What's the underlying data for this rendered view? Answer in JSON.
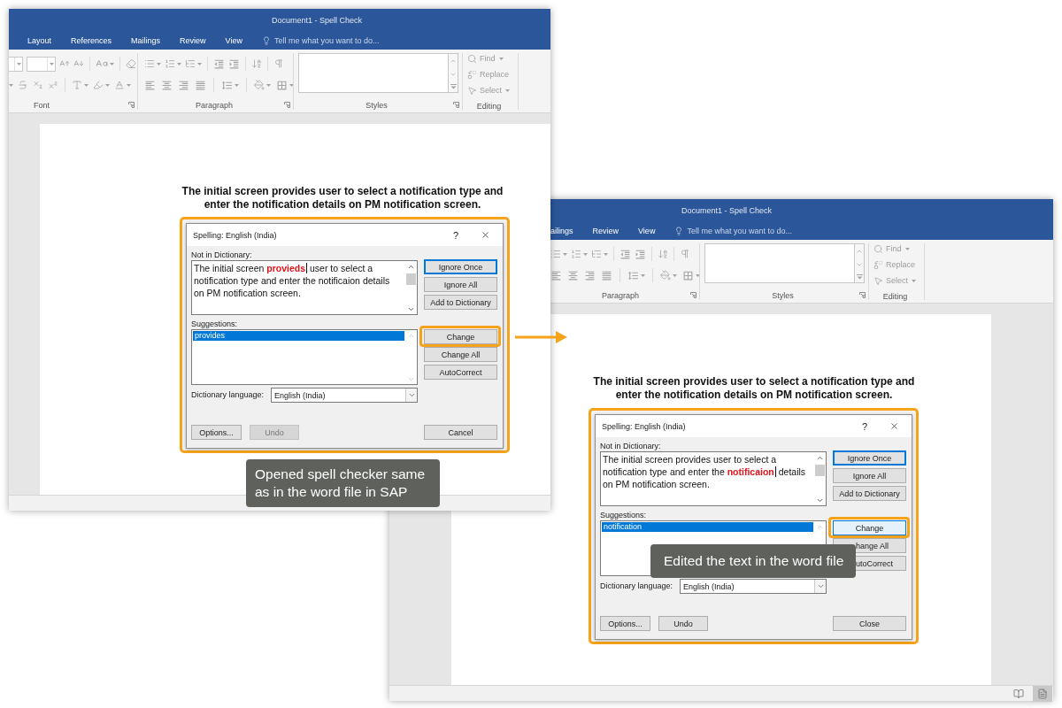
{
  "windows": [
    {
      "title": "Document1 - Spell Check",
      "tabs": [
        {
          "label": "Layout",
          "selected": false
        },
        {
          "label": "References",
          "selected": false
        },
        {
          "label": "Mailings",
          "selected": false
        },
        {
          "label": "Review",
          "selected": false
        },
        {
          "label": "View",
          "selected": false
        }
      ],
      "tell_me": {
        "placeholder": "Tell me what you want to do..."
      },
      "ribbon": {
        "disabled": true,
        "groups": [
          {
            "kind": "font",
            "label": "Font"
          },
          {
            "kind": "paragraph",
            "label": "Paragraph"
          },
          {
            "kind": "styles",
            "label": "Styles"
          },
          {
            "kind": "editing",
            "label": "Editing",
            "items": [
              {
                "kind": "find",
                "label": "Find"
              },
              {
                "kind": "replace",
                "label": "Replace"
              },
              {
                "kind": "select",
                "label": "Select"
              }
            ]
          }
        ]
      },
      "document": {
        "heading": "The initial screen provides user to select a notification type and\nenter the notification details on PM notification screen."
      },
      "dialog": {
        "title": "Spelling: English (India)",
        "help": "?",
        "not_in_dictionary": {
          "label": "Not in Dictionary:",
          "text": "The initial screen **provieds** user to select a\nnotification type and enter the notificaion details\non PM notification screen."
        },
        "dictionary_buttons": [
          {
            "label": "Ignore Once",
            "focused": true,
            "hovered": false,
            "annotated": false
          },
          {
            "label": "Ignore All",
            "focused": false,
            "hovered": false,
            "annotated": false
          },
          {
            "label": "Add to Dictionary",
            "focused": false,
            "hovered": false,
            "annotated": false
          }
        ],
        "suggestions": {
          "label": "Suggestions:",
          "items": [
            {
              "label": "provides",
              "selected": true
            }
          ]
        },
        "change_buttons": [
          {
            "label": "Change",
            "focused": false,
            "hovered": false,
            "annotated": true
          },
          {
            "label": "Change All",
            "focused": false,
            "hovered": false,
            "annotated": false
          },
          {
            "label": "AutoCorrect",
            "focused": false,
            "hovered": false,
            "annotated": false
          }
        ],
        "language": {
          "label": "Dictionary language:",
          "value": "English (India)"
        },
        "footer_buttons": [
          {
            "label": "Options...",
            "disabled": false
          },
          {
            "label": "Undo",
            "disabled": true
          }
        ],
        "dismiss_button": {
          "label": "Cancel"
        }
      },
      "callout": "Opened spell checker same\nas in the word file in SAP"
    },
    {
      "title": "Document1 - Spell Check",
      "tabs": [
        {
          "label": "ailings",
          "selected": false
        },
        {
          "label": "Review",
          "selected": false
        },
        {
          "label": "View",
          "selected": false
        }
      ],
      "tell_me": {
        "placeholder": "Tell me what you want to do..."
      },
      "ribbon": {
        "disabled": true,
        "groups": [
          {
            "kind": "paragraph",
            "label": "Paragraph"
          },
          {
            "kind": "styles",
            "label": "Styles"
          },
          {
            "kind": "editing",
            "label": "Editing",
            "items": [
              {
                "kind": "find",
                "label": "Find"
              },
              {
                "kind": "replace",
                "label": "Replace"
              },
              {
                "kind": "select",
                "label": "Select"
              }
            ]
          }
        ]
      },
      "document": {
        "heading": "The initial screen provides user to select a notification type and\nenter the notification details on PM notification screen."
      },
      "dialog": {
        "title": "Spelling: English (India)",
        "help": "?",
        "not_in_dictionary": {
          "label": "Not in Dictionary:",
          "text": "The initial screen provides user to select a\nnotification type and enter the **notificaion** details\non PM notification screen."
        },
        "dictionary_buttons": [
          {
            "label": "Ignore Once",
            "focused": true,
            "hovered": false,
            "annotated": false
          },
          {
            "label": "Ignore All",
            "focused": false,
            "hovered": false,
            "annotated": false
          },
          {
            "label": "Add to Dictionary",
            "focused": false,
            "hovered": false,
            "annotated": false
          }
        ],
        "suggestions": {
          "label": "Suggestions:",
          "items": [
            {
              "label": "notification",
              "selected": true
            }
          ]
        },
        "change_buttons": [
          {
            "label": "Change",
            "focused": false,
            "hovered": true,
            "annotated": true
          },
          {
            "label": "hange All",
            "focused": false,
            "hovered": false,
            "annotated": false
          },
          {
            "label": "utoCorrect",
            "focused": false,
            "hovered": false,
            "annotated": false
          }
        ],
        "language": {
          "label": "Dictionary language:",
          "value": "English (India)"
        },
        "footer_buttons": [
          {
            "label": "Options...",
            "disabled": false
          },
          {
            "label": "Undo",
            "disabled": false
          }
        ],
        "dismiss_button": {
          "label": "Close"
        }
      },
      "callout": "Edited the text in the word file",
      "status_bar": {
        "views": [
          {
            "kind": "read",
            "selected": false
          },
          {
            "kind": "print",
            "selected": true
          }
        ]
      }
    }
  ]
}
